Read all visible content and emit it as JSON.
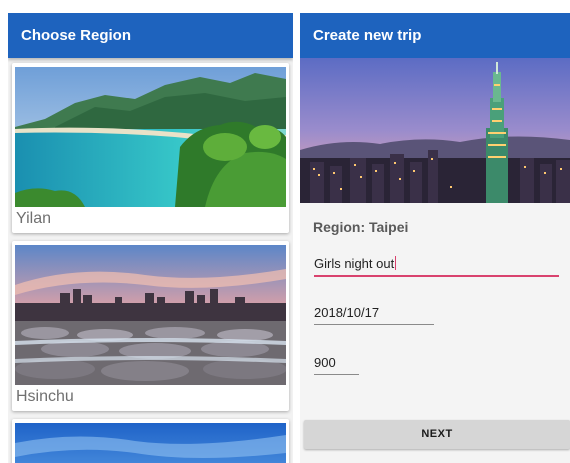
{
  "left_screen": {
    "title": "Choose Region",
    "regions": [
      {
        "name": "Yilan"
      },
      {
        "name": "Hsinchu"
      }
    ]
  },
  "right_screen": {
    "title": "Create new trip",
    "region_label": "Region: Taipei",
    "trip_name": "Girls night out",
    "date": "2018/10/17",
    "budget": "900",
    "next_label": "NEXT"
  },
  "colors": {
    "appbar": "#1e63be",
    "focus_underline": "#d9426e",
    "button": "#d6d6d6"
  }
}
